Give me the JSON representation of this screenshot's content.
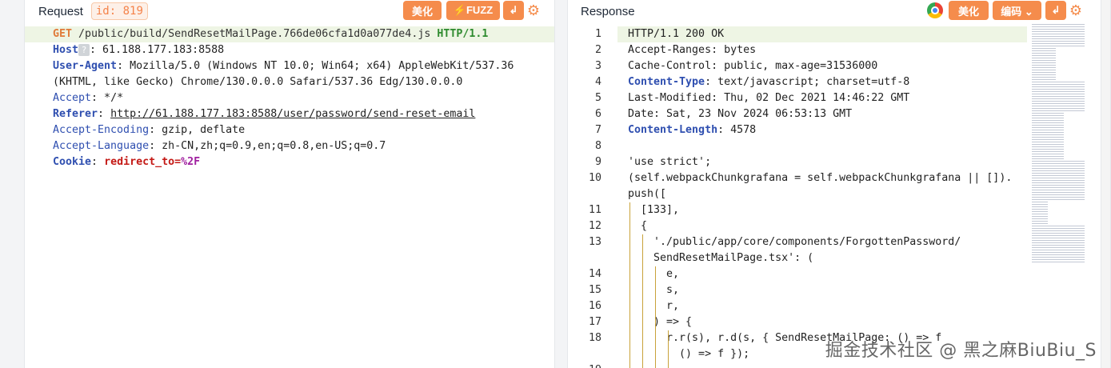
{
  "request": {
    "title": "Request",
    "id_badge": "id: 819",
    "btn_beautify": "美化",
    "btn_fuzz": "⚡FUZZ",
    "btn_wrap": "↲",
    "lines": {
      "method": "GET",
      "path": " /public/build/SendResetMailPage.766de06cfa1d0a077de4.js ",
      "proto": "HTTP/1.1",
      "host_key": "Host",
      "host_val": ": 61.188.177.183:8588",
      "ua_key": "User-Agent",
      "ua_val": ": Mozilla/5.0 (Windows NT 10.0; Win64; x64) AppleWebKit/537.36",
      "ua_val2": "(KHTML, like Gecko) Chrome/130.0.0.0 Safari/537.36 Edg/130.0.0.0",
      "accept_key": "Accept",
      "accept_val": ": */*",
      "referer_key": "Referer",
      "referer_sep": ": ",
      "referer_val": "http://61.188.177.183:8588/user/password/send-reset-email",
      "enc_key": "Accept-Encoding",
      "enc_val": ": gzip, deflate",
      "lang_key": "Accept-Language",
      "lang_val": ": zh-CN,zh;q=0.9,en;q=0.8,en-US;q=0.7",
      "cookie_key": "Cookie",
      "cookie_sep": ": ",
      "cookie_val": "redirect_to=",
      "cookie_pct": "%2F"
    }
  },
  "response": {
    "title": "Response",
    "btn_beautify": "美化",
    "btn_encoding": "编码 ⌄",
    "btn_wrap": "↲",
    "lines": [
      {
        "n": "1",
        "parts": [
          {
            "t": "HTTP/1.1 200 OK",
            "c": "val"
          }
        ]
      },
      {
        "n": "2",
        "parts": [
          {
            "t": "Accept-Ranges: bytes",
            "c": "val"
          }
        ]
      },
      {
        "n": "3",
        "parts": [
          {
            "t": "Cache-Control: public, max-age=31536000",
            "c": "val"
          }
        ]
      },
      {
        "n": "4",
        "parts": [
          {
            "t": "Content-Type",
            "c": "hk"
          },
          {
            "t": ": text/javascript; charset=utf-8",
            "c": "val"
          }
        ]
      },
      {
        "n": "5",
        "parts": [
          {
            "t": "Last-Modified: Thu, 02 Dec 2021 14:46:22 GMT",
            "c": "val"
          }
        ]
      },
      {
        "n": "6",
        "parts": [
          {
            "t": "Date: Sat, 23 Nov 2024 06:53:13 GMT",
            "c": "val"
          }
        ]
      },
      {
        "n": "7",
        "parts": [
          {
            "t": "Content-Length",
            "c": "hk"
          },
          {
            "t": ": 4578",
            "c": "val"
          }
        ]
      },
      {
        "n": "8",
        "parts": []
      },
      {
        "n": "9",
        "parts": [
          {
            "t": "'use strict';",
            "c": "val"
          }
        ]
      },
      {
        "n": "10",
        "parts": [
          {
            "t": "(self.webpackChunkgrafana = self.webpackChunkgrafana || []).",
            "c": "val"
          }
        ]
      },
      {
        "n": "",
        "parts": [
          {
            "t": "push([",
            "c": "val"
          }
        ]
      },
      {
        "n": "11",
        "parts": [
          {
            "t": "  [133],",
            "c": "val"
          }
        ]
      },
      {
        "n": "12",
        "parts": [
          {
            "t": "  {",
            "c": "val"
          }
        ]
      },
      {
        "n": "13",
        "parts": [
          {
            "t": "    './public/app/core/components/ForgottenPassword/",
            "c": "val"
          }
        ]
      },
      {
        "n": "",
        "parts": [
          {
            "t": "    SendResetMailPage.tsx': (",
            "c": "val"
          }
        ]
      },
      {
        "n": "14",
        "parts": [
          {
            "t": "      e,",
            "c": "val"
          }
        ]
      },
      {
        "n": "15",
        "parts": [
          {
            "t": "      s,",
            "c": "val"
          }
        ]
      },
      {
        "n": "16",
        "parts": [
          {
            "t": "      r,",
            "c": "val"
          }
        ]
      },
      {
        "n": "17",
        "parts": [
          {
            "t": "    ) => {",
            "c": "val"
          }
        ]
      },
      {
        "n": "18",
        "parts": [
          {
            "t": "      r.r(s), r.d(s, { SendResetMailPage: () => f",
            "c": "val"
          }
        ]
      },
      {
        "n": "",
        "parts": [
          {
            "t": "        () => f });",
            "c": "val"
          }
        ]
      },
      {
        "n": "19",
        "parts": []
      }
    ]
  },
  "watermark": "掘金技术社区 @ 黑之麻BiuBiu_S"
}
